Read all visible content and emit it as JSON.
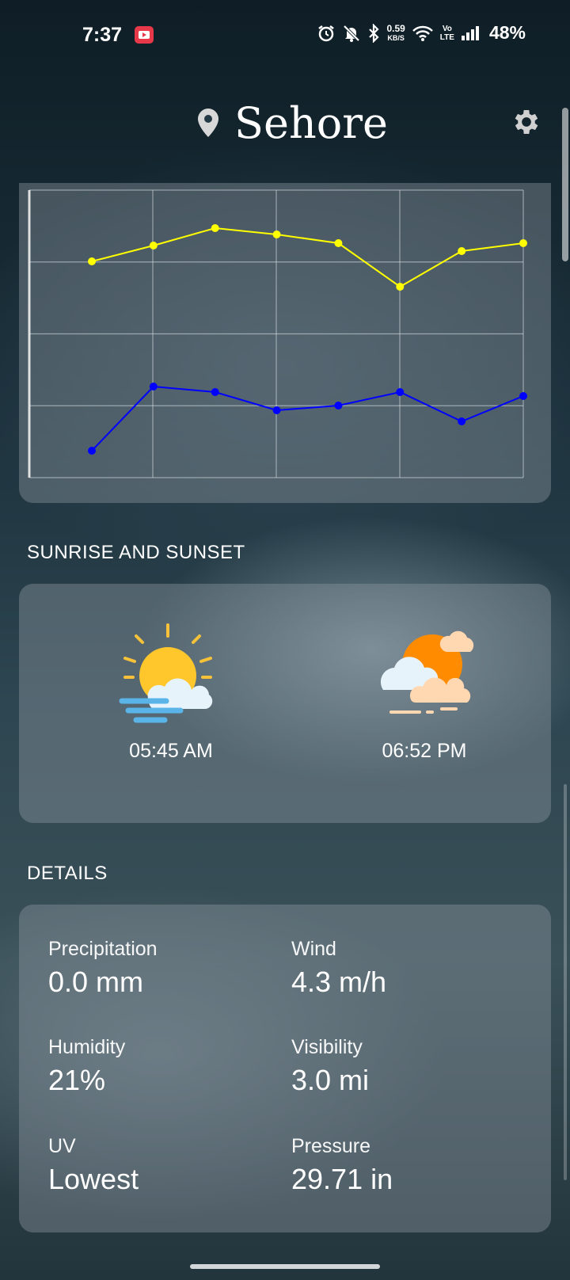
{
  "status_bar": {
    "time": "7:37",
    "net_speed_value": "0.59",
    "net_speed_unit": "KB/S",
    "volte_top": "Vo",
    "volte_bottom": "LTE",
    "battery": "48%",
    "icons": [
      "youtube-notification-icon",
      "alarm-icon",
      "do-not-disturb-icon",
      "bluetooth-icon",
      "wifi-icon",
      "signal-icon"
    ]
  },
  "header": {
    "city": "Sehore",
    "icons": [
      "location-pin-icon",
      "settings-icon"
    ]
  },
  "chart_data": {
    "type": "line",
    "series": [
      {
        "color": "#ffff00",
        "values": [
          330,
          310,
          288,
          296,
          307,
          362,
          317,
          307
        ]
      },
      {
        "color": "#0000ff",
        "values": [
          569,
          488,
          495,
          518,
          512,
          495,
          532,
          500
        ]
      }
    ],
    "grid": true,
    "axis_labels_shown": false,
    "note_values_are_relative_positions": true
  },
  "sun": {
    "title": "SUNRISE AND SUNSET",
    "sunrise_time": "05:45 AM",
    "sunset_time": "06:52 PM"
  },
  "details": {
    "title": "DETAILS",
    "items": [
      {
        "label": "Precipitation",
        "value": "0.0 mm"
      },
      {
        "label": "Wind",
        "value": "4.3 m/h"
      },
      {
        "label": "Humidity",
        "value": "21%"
      },
      {
        "label": "Visibility",
        "value": "3.0 mi"
      },
      {
        "label": "UV",
        "value": "Lowest"
      },
      {
        "label": "Pressure",
        "value": "29.71 in"
      }
    ]
  },
  "colors": {
    "series_max": "#ffff00",
    "series_min": "#0000ff",
    "card_bg": "rgba(140,150,160,0.42)"
  }
}
